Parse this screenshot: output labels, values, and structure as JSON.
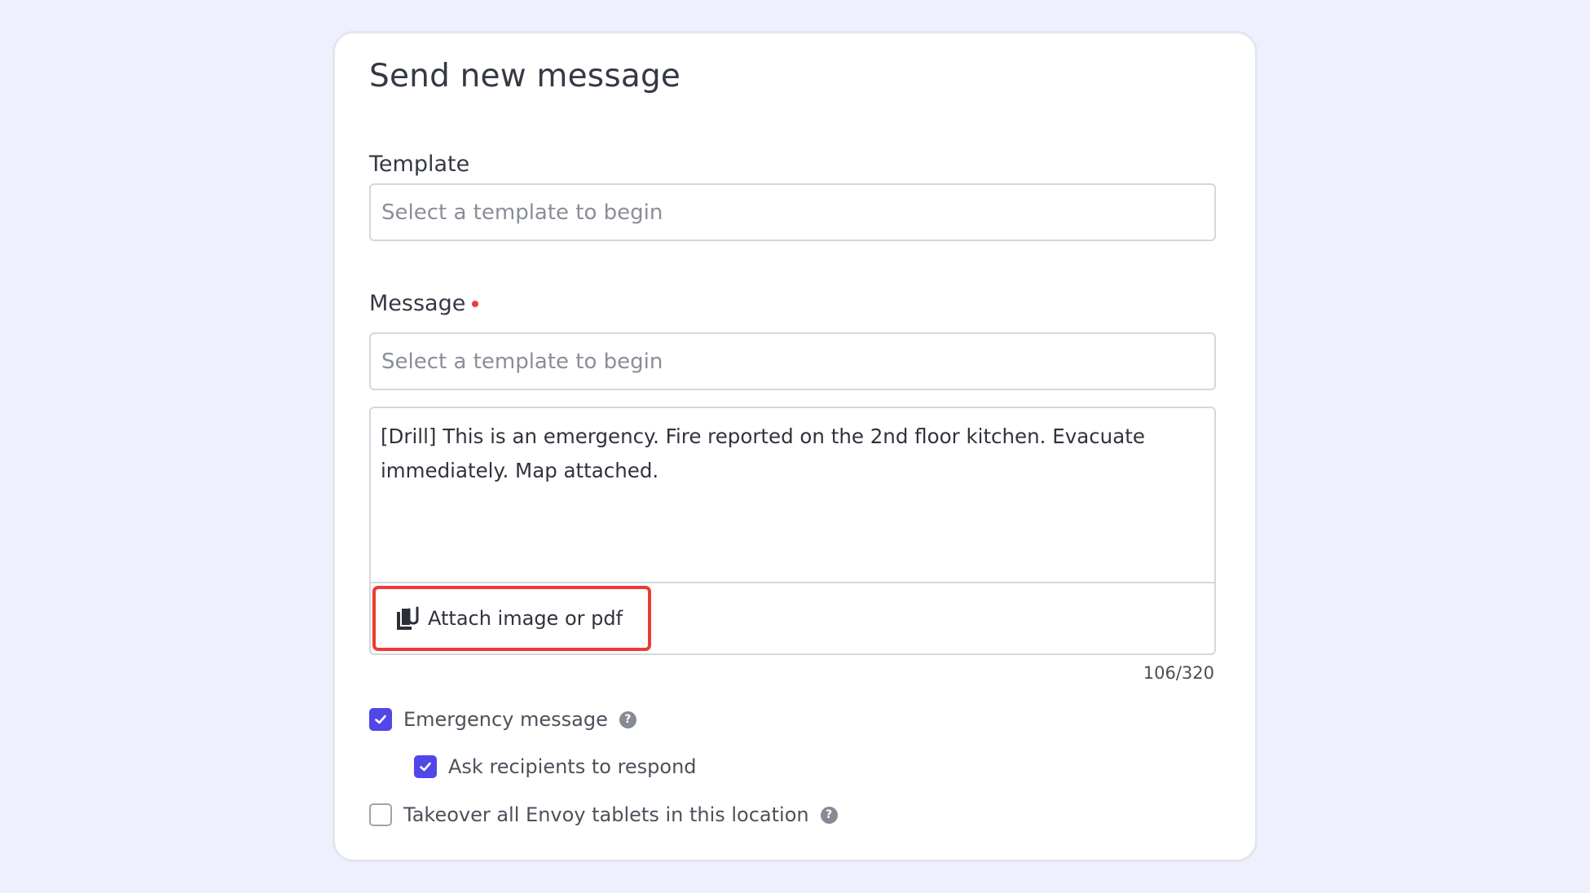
{
  "form": {
    "title": "Send new message",
    "template_label": "Template",
    "template_placeholder": "Select a template to begin",
    "message_label": "Message",
    "message_template_placeholder": "Select a template to begin",
    "message_body": "[Drill] This is an emergency. Fire reported on the 2nd floor kitchen. Evacuate immediately. Map attached.",
    "attach_label": "Attach image or pdf",
    "char_count": "106/320",
    "options": {
      "emergency": {
        "label": "Emergency message",
        "checked": true,
        "help_icon": "question-circle-icon"
      },
      "ask_respond": {
        "label": "Ask recipients to respond",
        "checked": true
      },
      "takeover": {
        "label": "Takeover all Envoy tablets in this location",
        "checked": false,
        "help_icon": "question-circle-icon"
      }
    },
    "help_glyph": "?"
  },
  "colors": {
    "page_background": "#eef1fd",
    "card_background": "#ffffff",
    "checkbox_checked": "#5146e8",
    "required_dot": "#ef3b3b",
    "highlight_outline": "#ec3b33"
  },
  "icons": {
    "attach": "paperclip-document-icon",
    "check": "checkmark-icon",
    "help": "question-circle-icon"
  }
}
